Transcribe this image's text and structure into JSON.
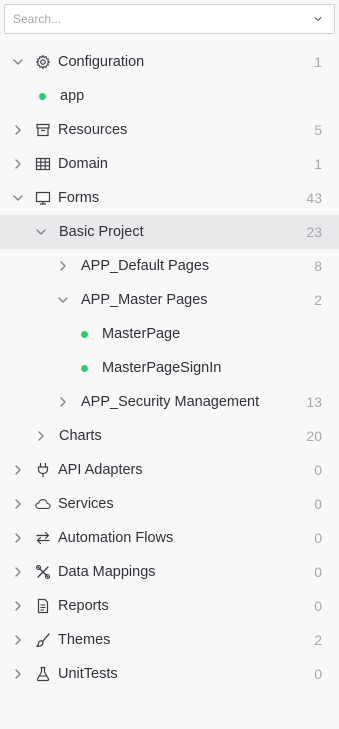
{
  "search": {
    "placeholder": "Search...",
    "value": ""
  },
  "tree": [
    {
      "label": "Configuration",
      "count": "1",
      "icon": "gear-icon",
      "expanded": true,
      "depth": 0
    },
    {
      "label": "app",
      "count": "",
      "icon": "green-dot",
      "depth": 1
    },
    {
      "label": "Resources",
      "count": "5",
      "icon": "archive-box-icon",
      "expanded": false,
      "depth": 0
    },
    {
      "label": "Domain",
      "count": "1",
      "icon": "table-grid-icon",
      "expanded": false,
      "depth": 0
    },
    {
      "label": "Forms",
      "count": "43",
      "icon": "monitor-icon",
      "expanded": true,
      "depth": 0
    },
    {
      "label": "Basic Project",
      "count": "23",
      "expanded": true,
      "selected": true,
      "depth": 1
    },
    {
      "label": "APP_Default Pages",
      "count": "8",
      "expanded": false,
      "depth": 2
    },
    {
      "label": "APP_Master Pages",
      "count": "2",
      "expanded": true,
      "depth": 2
    },
    {
      "label": "MasterPage",
      "count": "",
      "icon": "green-dot",
      "depth": 3
    },
    {
      "label": "MasterPageSignIn",
      "count": "",
      "icon": "green-dot",
      "depth": 3
    },
    {
      "label": "APP_Security Management",
      "count": "13",
      "expanded": false,
      "depth": 2
    },
    {
      "label": "Charts",
      "count": "20",
      "expanded": false,
      "depth": 1
    },
    {
      "label": "API Adapters",
      "count": "0",
      "icon": "plug-icon",
      "expanded": false,
      "depth": 0
    },
    {
      "label": "Services",
      "count": "0",
      "icon": "cloud-icon",
      "expanded": false,
      "depth": 0
    },
    {
      "label": "Automation Flows",
      "count": "0",
      "icon": "arrows-exchange-icon",
      "expanded": false,
      "depth": 0
    },
    {
      "label": "Data Mappings",
      "count": "0",
      "icon": "crossed-tools-icon",
      "expanded": false,
      "depth": 0
    },
    {
      "label": "Reports",
      "count": "0",
      "icon": "document-icon",
      "expanded": false,
      "depth": 0
    },
    {
      "label": "Themes",
      "count": "2",
      "icon": "brush-icon",
      "expanded": false,
      "depth": 0
    },
    {
      "label": "UnitTests",
      "count": "0",
      "icon": "flask-icon",
      "expanded": false,
      "depth": 0
    }
  ],
  "colors": {
    "background": "#f8f8f9",
    "selected_row": "#e9e9ec",
    "status_dot": "#2ecc71",
    "text": "#2e3138",
    "muted": "#a4a8ae"
  }
}
